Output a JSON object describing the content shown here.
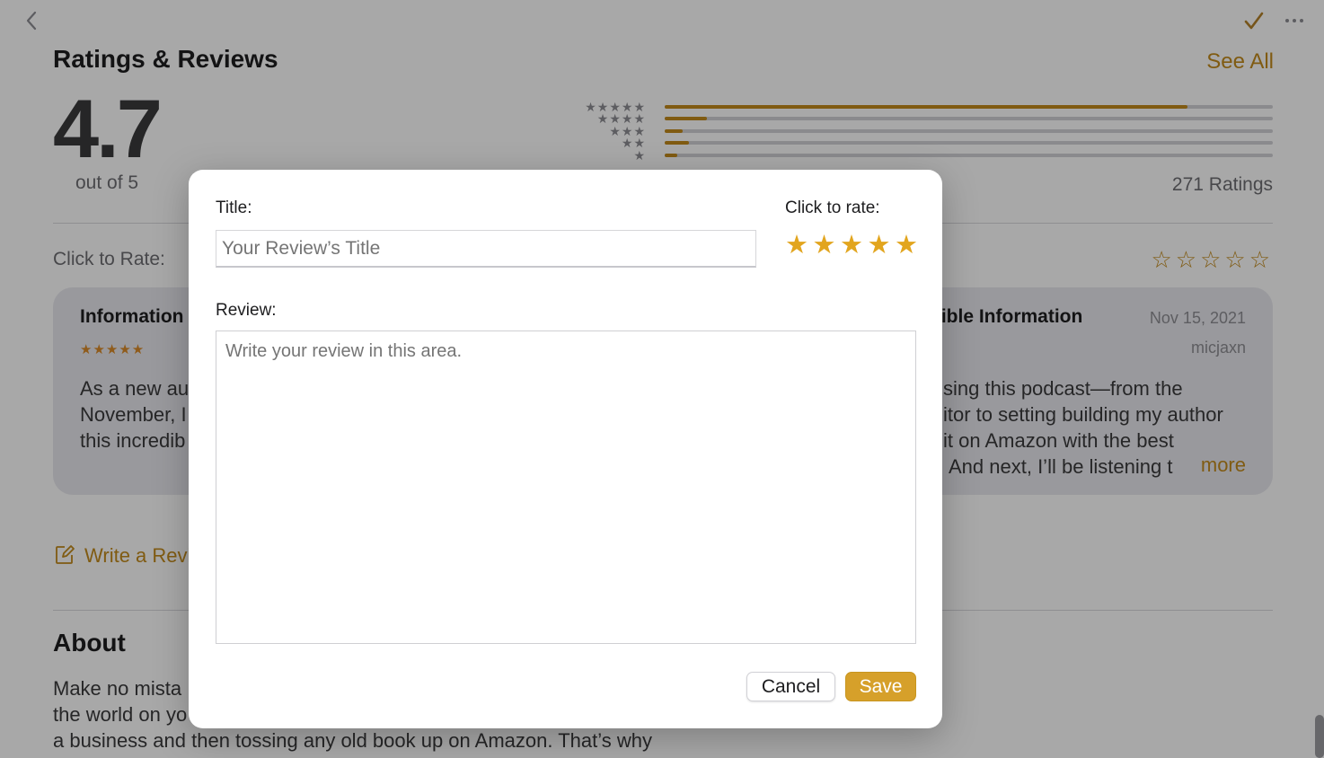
{
  "topbar": {
    "back_icon": "chevron-left-icon",
    "check_icon": "checkmark-icon",
    "more_icon": "ellipsis-icon"
  },
  "ratings": {
    "title": "Ratings & Reviews",
    "see_all": "See All",
    "average": "4.7",
    "out_of": "out of 5",
    "count": "271 Ratings",
    "distribution": [
      {
        "stars": "★★★★★",
        "fraction": 0.86
      },
      {
        "stars": "★★★★",
        "fraction": 0.07
      },
      {
        "stars": "★★★",
        "fraction": 0.03
      },
      {
        "stars": "★★",
        "fraction": 0.04
      },
      {
        "stars": "★",
        "fraction": 0.02
      }
    ],
    "bar_color": "#c28a1c"
  },
  "click_to_rate": {
    "label": "Click to Rate:",
    "stars": "☆☆☆☆☆"
  },
  "review_cards": [
    {
      "title": "Information",
      "stars": "★★★★★",
      "lines": [
        "As a new au",
        "November, I",
        "this incredib"
      ]
    },
    {
      "title": "lible Information",
      "date": "Nov 15, 2021",
      "author": "micjaxn",
      "lines": [
        "sing this podcast—from the",
        "itor to setting building my author",
        "it on Amazon with the best",
        "And next, I’ll be listening t"
      ],
      "more": "more"
    }
  ],
  "write_review": {
    "label": "Write a Revi",
    "icon": "compose-icon"
  },
  "about": {
    "title": "About",
    "lines": [
      "Make no mista",
      "the world on yo",
      "a business and then tossing any old book up on Amazon. That’s why"
    ]
  },
  "dialog": {
    "title_label": "Title:",
    "title_placeholder": "Your Review’s Title",
    "rate_label": "Click to rate:",
    "rating": "5",
    "review_label": "Review:",
    "review_placeholder": "Write your review in this area.",
    "cancel": "Cancel",
    "save": "Save",
    "accent": "#d6a02a"
  }
}
